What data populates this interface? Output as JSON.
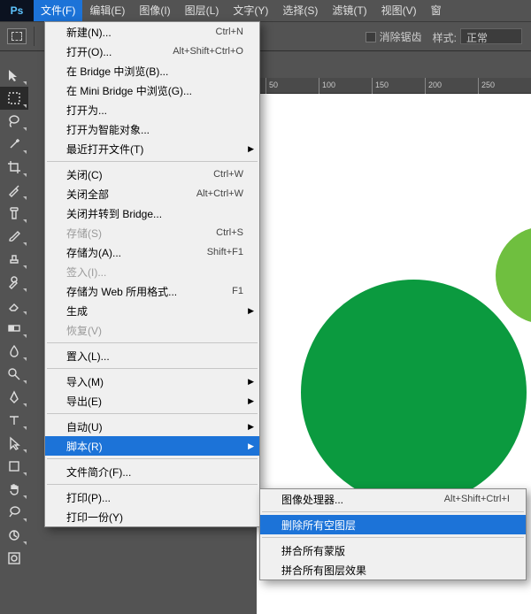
{
  "app": {
    "logo": "Ps"
  },
  "menubar": [
    {
      "label": "文件(F)",
      "active": true
    },
    {
      "label": "编辑(E)"
    },
    {
      "label": "图像(I)"
    },
    {
      "label": "图层(L)"
    },
    {
      "label": "文字(Y)"
    },
    {
      "label": "选择(S)"
    },
    {
      "label": "滤镜(T)"
    },
    {
      "label": "视图(V)"
    },
    {
      "label": "窗"
    }
  ],
  "optbar": {
    "antialias_label": "消除锯齿",
    "style_label": "样式:",
    "style_value": "正常",
    "ruler_hint": ""
  },
  "ruler": {
    "ticks": [
      "50",
      "100",
      "150",
      "200",
      "250"
    ]
  },
  "canvas": {
    "main_circle_color": "#0b9a3f",
    "side_circle_color": "#6fbf3f"
  },
  "file_menu": [
    {
      "label": "新建(N)...",
      "accel": "Ctrl+N"
    },
    {
      "label": "打开(O)...",
      "accel": "Alt+Shift+Ctrl+O"
    },
    {
      "label": "在 Bridge 中浏览(B)..."
    },
    {
      "label": "在 Mini Bridge 中浏览(G)..."
    },
    {
      "label": "打开为..."
    },
    {
      "label": "打开为智能对象..."
    },
    {
      "label": "最近打开文件(T)",
      "sub": true
    },
    {
      "sep": true
    },
    {
      "label": "关闭(C)",
      "accel": "Ctrl+W"
    },
    {
      "label": "关闭全部",
      "accel": "Alt+Ctrl+W"
    },
    {
      "label": "关闭并转到 Bridge..."
    },
    {
      "label": "存储(S)",
      "accel": "Ctrl+S",
      "disabled": true
    },
    {
      "label": "存储为(A)...",
      "accel": "Shift+F1"
    },
    {
      "label": "签入(I)...",
      "disabled": true
    },
    {
      "label": "存储为 Web 所用格式...",
      "accel": "F1"
    },
    {
      "label": "生成",
      "sub": true
    },
    {
      "label": "恢复(V)",
      "disabled": true
    },
    {
      "sep": true
    },
    {
      "label": "置入(L)..."
    },
    {
      "sep": true
    },
    {
      "label": "导入(M)",
      "sub": true
    },
    {
      "label": "导出(E)",
      "sub": true
    },
    {
      "sep": true
    },
    {
      "label": "自动(U)",
      "sub": true
    },
    {
      "label": "脚本(R)",
      "sub": true,
      "hover": true
    },
    {
      "sep": true
    },
    {
      "label": "文件简介(F)..."
    },
    {
      "sep": true
    },
    {
      "label": "打印(P)..."
    },
    {
      "label": "打印一份(Y)"
    }
  ],
  "script_menu": [
    {
      "label": "图像处理器...",
      "accel": "Alt+Shift+Ctrl+I"
    },
    {
      "sep": true
    },
    {
      "label": "删除所有空图层",
      "hover": true
    },
    {
      "sep": true
    },
    {
      "label": "拼合所有蒙版"
    },
    {
      "label": "拼合所有图层效果"
    }
  ],
  "tools": [
    "move",
    "marquee",
    "lasso",
    "magic-wand",
    "crop",
    "eyedropper",
    "spot-heal",
    "brush",
    "clone-stamp",
    "history-brush",
    "eraser",
    "gradient",
    "blur",
    "dodge",
    "pen",
    "type",
    "path-select",
    "rectangle",
    "hand",
    "zoom",
    "rotate",
    "foreground"
  ]
}
